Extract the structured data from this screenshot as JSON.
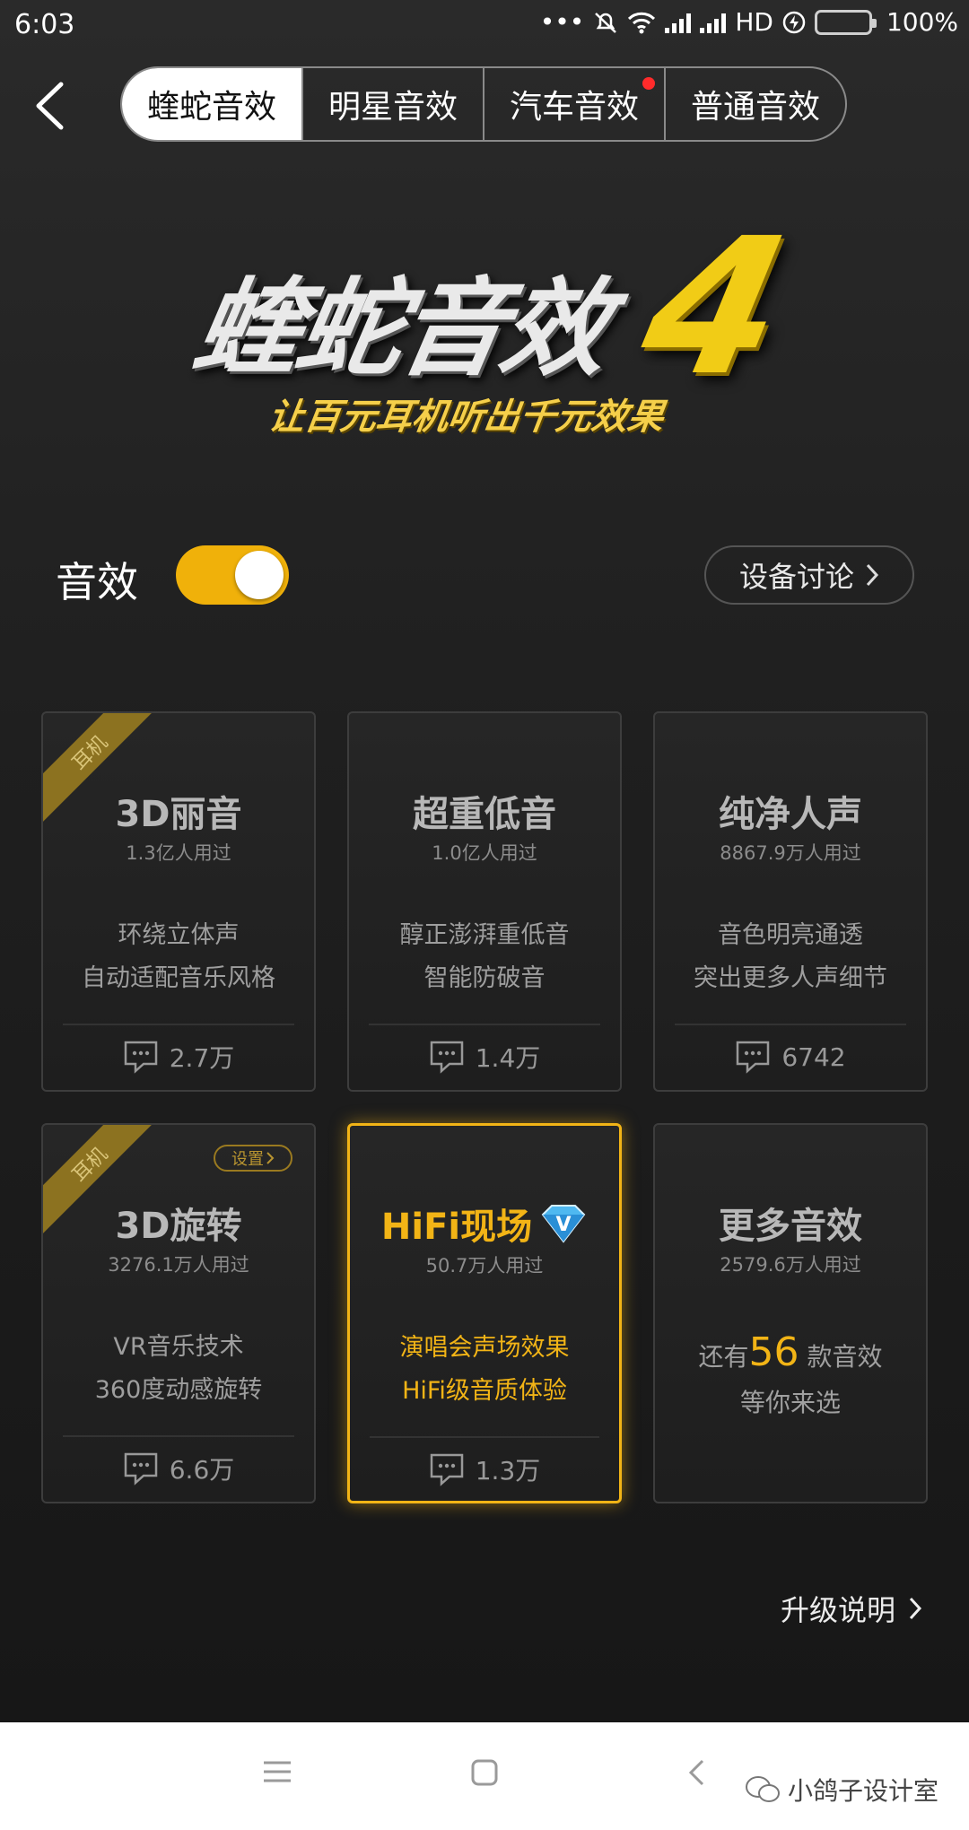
{
  "status_bar": {
    "time": "6:03",
    "network": "HD",
    "battery": "100%"
  },
  "header": {
    "tabs": [
      {
        "label": "蝰蛇音效",
        "active": true
      },
      {
        "label": "明星音效",
        "active": false
      },
      {
        "label": "汽车音效",
        "active": false,
        "has_dot": true
      },
      {
        "label": "普通音效",
        "active": false
      }
    ]
  },
  "hero": {
    "title": "蝰蛇音效",
    "version": "4",
    "subtitle": "让百元耳机听出千元效果"
  },
  "sound_toggle": {
    "label": "音效",
    "on": true
  },
  "discuss_button": {
    "label": "设备讨论"
  },
  "cards": [
    {
      "tag": "耳机",
      "name": "3D丽音",
      "users": "1.3亿人用过",
      "desc1": "环绕立体声",
      "desc2": "自动适配音乐风格",
      "comments": "2.7万"
    },
    {
      "name": "超重低音",
      "users": "1.0亿人用过",
      "desc1": "醇正澎湃重低音",
      "desc2": "智能防破音",
      "comments": "1.4万"
    },
    {
      "name": "纯净人声",
      "users": "8867.9万人用过",
      "desc1": "音色明亮通透",
      "desc2": "突出更多人声细节",
      "comments": "6742"
    },
    {
      "tag": "耳机",
      "settings": "设置",
      "name": "3D旋转",
      "users": "3276.1万人用过",
      "desc1": "VR音乐技术",
      "desc2": "360度动感旋转",
      "comments": "6.6万"
    },
    {
      "name": "HiFi现场",
      "badge": "V",
      "users": "50.7万人用过",
      "desc1": "演唱会声场效果",
      "desc2": "HiFi级音质体验",
      "comments": "1.3万"
    },
    {
      "name": "更多音效",
      "users": "2579.6万人用过",
      "more_prefix": "还有",
      "more_count": "56",
      "more_suffix": "款音效",
      "more_sub": "等你来选"
    }
  ],
  "upgrade_link": {
    "label": "升级说明"
  },
  "watermark": "小鸽子设计室",
  "colors": {
    "accent": "#f2b416",
    "toggle_on": "#f0b10a",
    "background": "#1f1f1f"
  }
}
